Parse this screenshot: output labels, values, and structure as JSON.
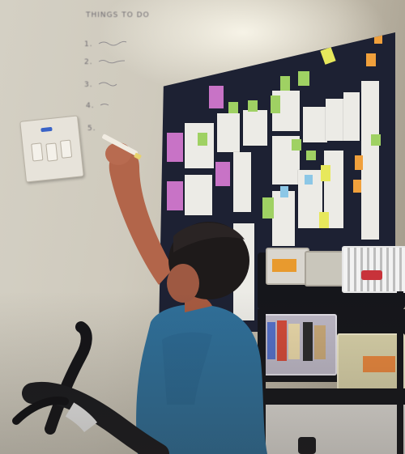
{
  "scene": {
    "description_label": "",
    "colors": {
      "wall": "#cfcabd",
      "board": "#1d2133",
      "shirt": "#2f6f99",
      "hair": "#1e1a1a",
      "skin": "#b2654a",
      "note_pink": "#c873c6",
      "note_green": "#9fd163",
      "note_yellow": "#e7e85c",
      "note_orange": "#f0a03c",
      "cart": "#15161b"
    },
    "handwriting_lines": [
      "THINGS TO DO",
      "1.",
      "2.",
      "3.",
      "4.",
      "5."
    ],
    "icons": [
      "light-switch-icon",
      "marker-icon"
    ]
  }
}
